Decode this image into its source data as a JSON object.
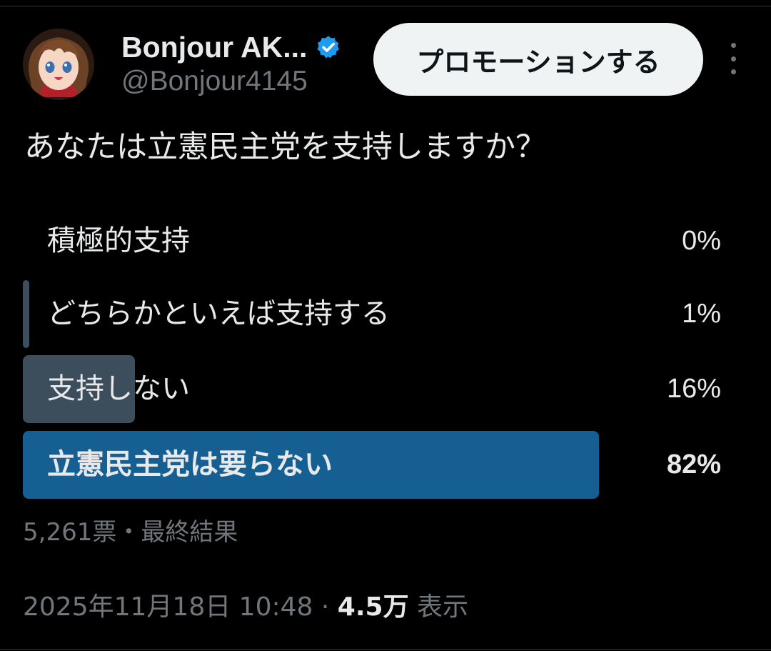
{
  "author": {
    "display_name": "Bonjour AK...",
    "handle": "@Bonjour4145",
    "verified_icon": "verified-badge-icon",
    "avatar": "anime-girl-avatar"
  },
  "promote_button": {
    "label": "プロモーションする"
  },
  "more_menu": {
    "icon": "more-vertical-icon"
  },
  "tweet": {
    "text": "あなたは立憲民主党を支持しますか？"
  },
  "poll": {
    "options": [
      {
        "label": "積極的支持",
        "percent": "0%",
        "value": 0
      },
      {
        "label": "どちらかといえば支持する",
        "percent": "1%",
        "value": 1
      },
      {
        "label": "支持しない",
        "percent": "16%",
        "value": 16
      },
      {
        "label": "立憲民主党は要らない",
        "percent": "82%",
        "value": 82,
        "winner": true
      }
    ],
    "votes": "5,261票",
    "separator": "・",
    "status": "最終結果"
  },
  "meta": {
    "timestamp": "2025年11月18日 10:48",
    "separator": "·",
    "views_count": "4.5万",
    "views_label": "表示"
  },
  "colors": {
    "background": "#000000",
    "text": "#e7e9ea",
    "muted": "#71767b",
    "poll_bar": "#3c4d5c",
    "poll_bar_winner": "#155f93",
    "verified": "#1d9bf0",
    "button_bg": "#eff3f4"
  }
}
